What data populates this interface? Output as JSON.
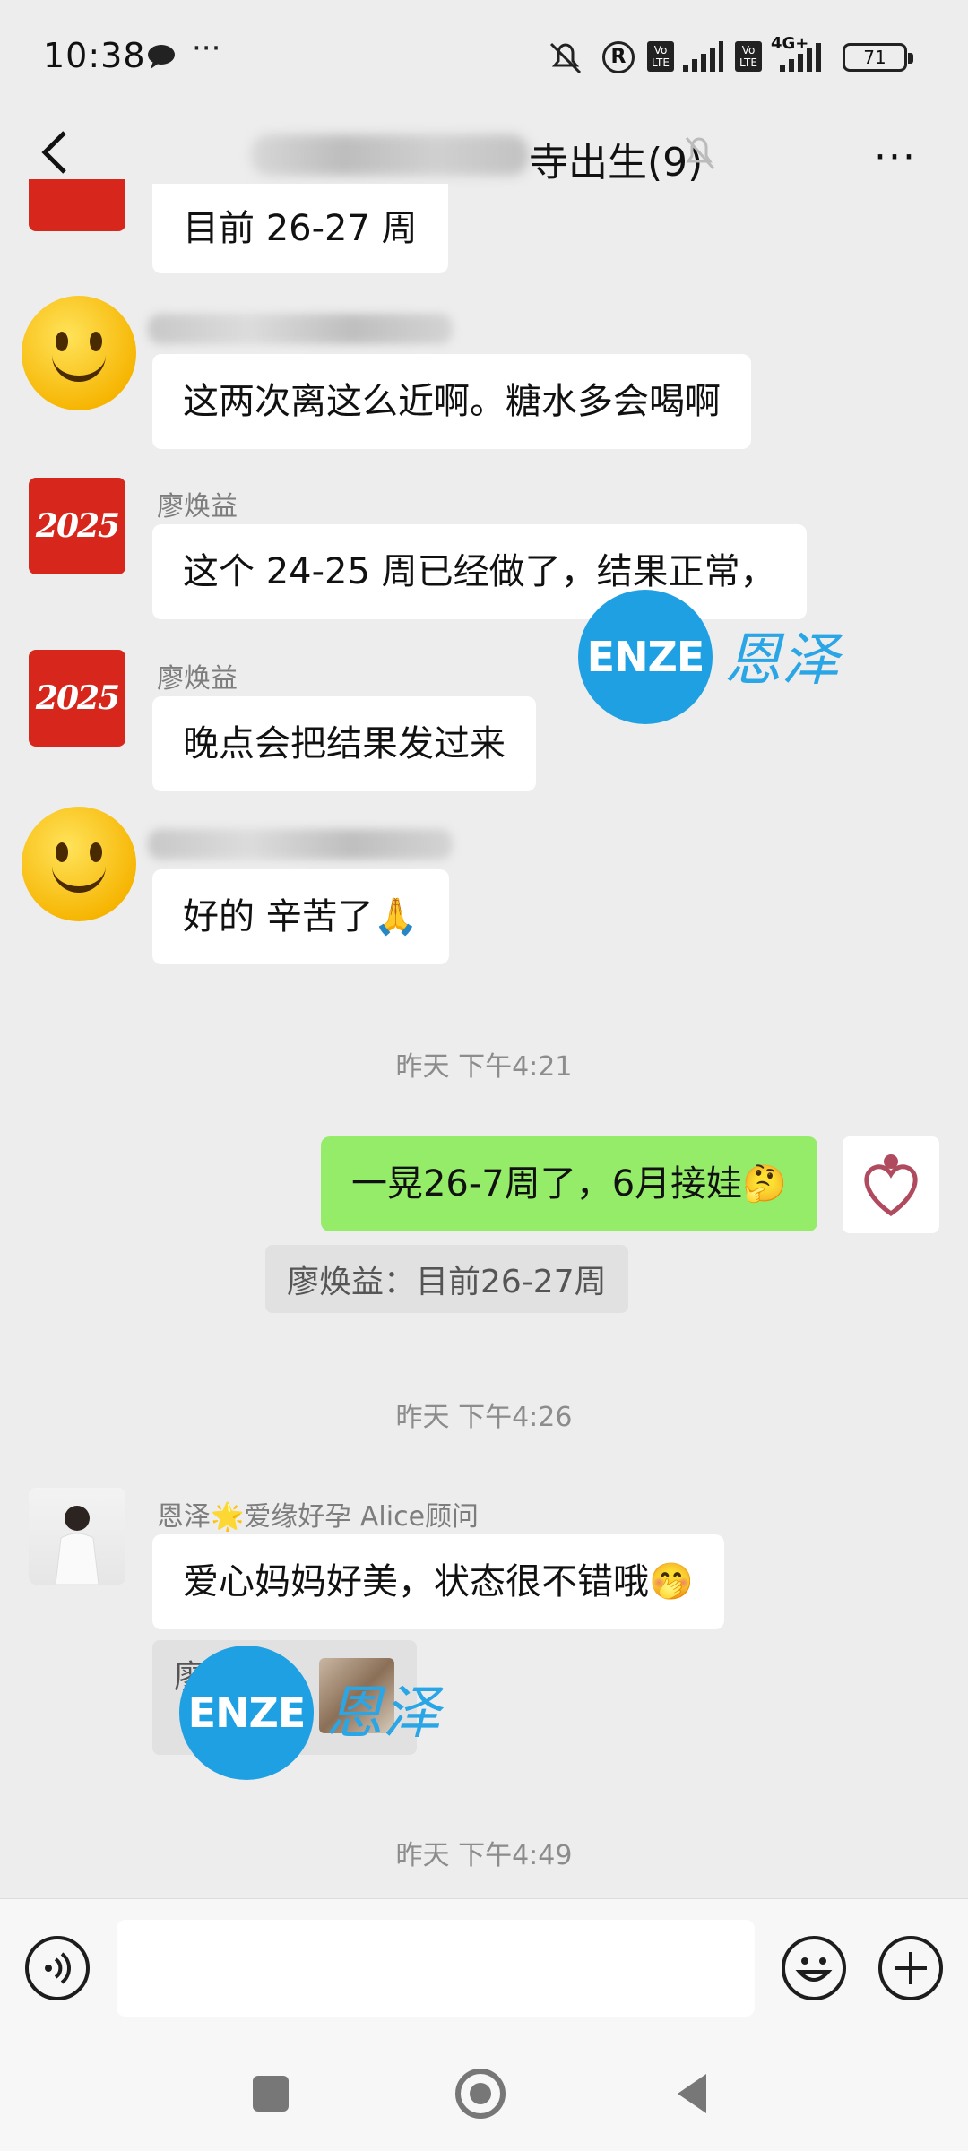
{
  "status_bar": {
    "time": "10:38",
    "icons": [
      "message-bubble-icon",
      "more-dots-icon",
      "silent-bell-icon",
      "registered-icon",
      "volte-icon",
      "signal-icon",
      "volte-icon",
      "signal-4g-icon"
    ],
    "network_label": "4G+",
    "volte_label": "Vo LTE",
    "registered_label": "R",
    "battery": "71"
  },
  "header": {
    "title": "寺出生(9)",
    "back_icon": "chevron-left-icon",
    "mute_icon": "bell-off-icon",
    "more_label": "···"
  },
  "messages": [
    {
      "sender": "",
      "text": "目前 26-27 周"
    },
    {
      "sender": "",
      "text": "这两次离这么近啊。糖水多会喝啊"
    },
    {
      "sender": "廖焕益",
      "text": "这个 24-25 周已经做了，结果正常，"
    },
    {
      "sender": "廖焕益",
      "text": "晚点会把结果发过来"
    },
    {
      "sender": "",
      "text": "好的 辛苦了🙏"
    },
    {
      "time": "昨天 下午4:21"
    },
    {
      "sender": "me",
      "text": "一晃26-7周了，6月接娃🤔",
      "quote": "廖焕益：目前26-27周"
    },
    {
      "time": "昨天 下午4:26"
    },
    {
      "sender": "恩泽🌟爱缘好孕 Alice顾问",
      "text": "爱心妈妈好美，状态很不错哦🤭",
      "quote_partial": "廖"
    },
    {
      "time": "昨天 下午4:49"
    }
  ],
  "watermark": {
    "logo": "ENZE",
    "text": "恩泽"
  },
  "input": {
    "placeholder": ""
  },
  "nav": {
    "icons": [
      "recent-apps-icon",
      "home-icon",
      "back-icon"
    ]
  },
  "colors": {
    "own_bubble": "#95ec69",
    "watermark": "#1ea0e3",
    "avatar_red": "#d7261b"
  }
}
